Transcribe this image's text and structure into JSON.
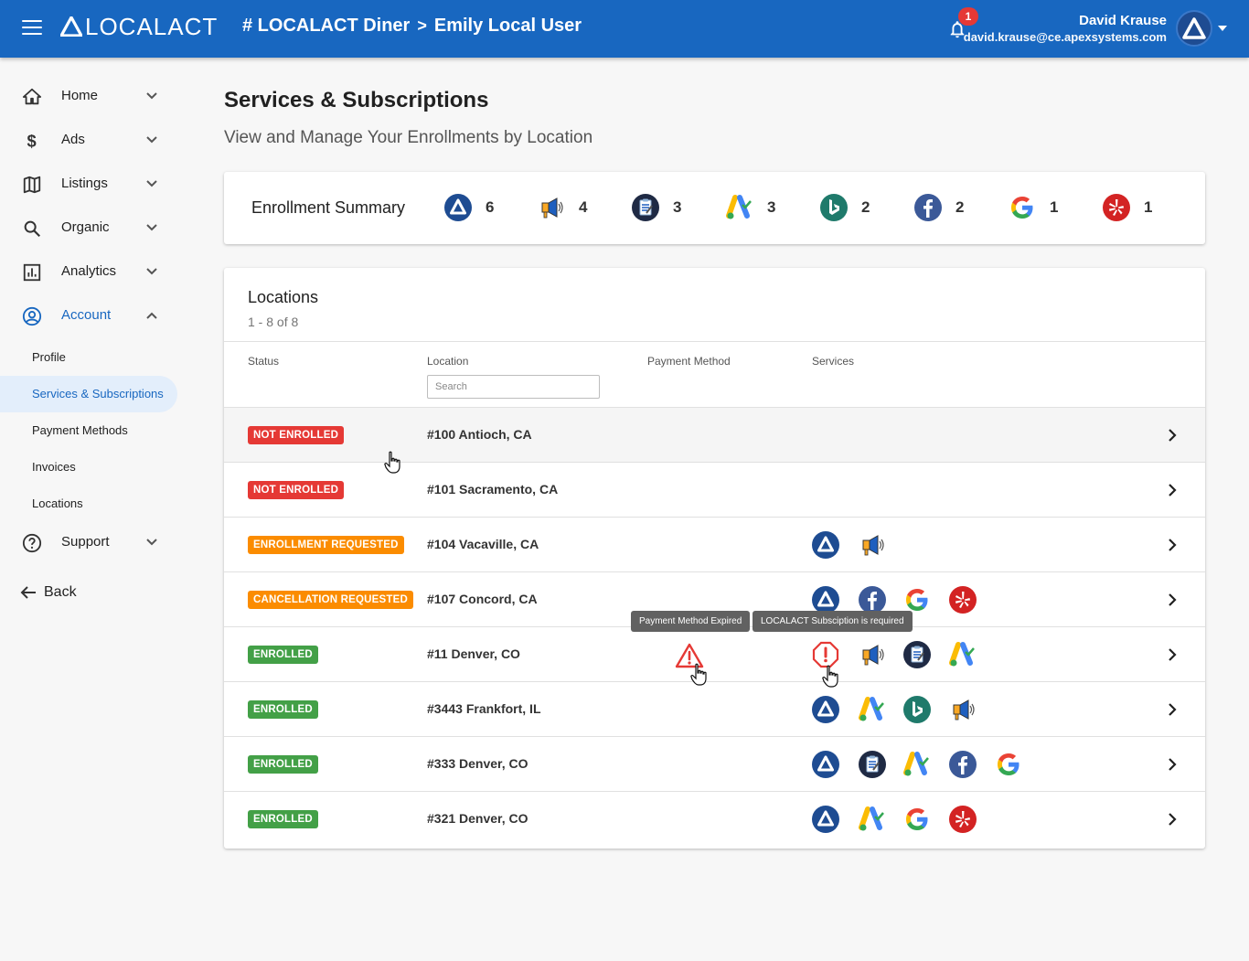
{
  "header": {
    "logo_text": "LOCALACT",
    "breadcrumb_store": "# LOCALACT Diner",
    "breadcrumb_sep": ">",
    "breadcrumb_user": "Emily Local User",
    "notifications_count": "1",
    "user_name": "David Krause",
    "user_email": "david.krause@ce.apexsystems.com"
  },
  "sidebar": {
    "items": [
      {
        "label": "Home",
        "icon": "home-icon"
      },
      {
        "label": "Ads",
        "icon": "dollar-icon"
      },
      {
        "label": "Listings",
        "icon": "map-icon"
      },
      {
        "label": "Organic",
        "icon": "search-icon"
      },
      {
        "label": "Analytics",
        "icon": "analytics-icon"
      },
      {
        "label": "Account",
        "icon": "account-circle-icon"
      }
    ],
    "account_sub": [
      "Profile",
      "Services & Subscriptions",
      "Payment Methods",
      "Invoices",
      "Locations"
    ],
    "support_label": "Support",
    "back_label": "Back"
  },
  "page": {
    "title": "Services & Subscriptions",
    "subtitle": "View and Manage Your Enrollments by Location"
  },
  "summary": {
    "title": "Enrollment Summary",
    "items": [
      {
        "service": "localact",
        "count": "6"
      },
      {
        "service": "megaphone",
        "count": "4"
      },
      {
        "service": "clipboard",
        "count": "3"
      },
      {
        "service": "google-ads",
        "count": "3"
      },
      {
        "service": "bing",
        "count": "2"
      },
      {
        "service": "facebook",
        "count": "2"
      },
      {
        "service": "google",
        "count": "1"
      },
      {
        "service": "yelp",
        "count": "1"
      }
    ]
  },
  "locations": {
    "title": "Locations",
    "range": "1 - 8 of 8",
    "columns": {
      "status": "Status",
      "location": "Location",
      "payment": "Payment Method",
      "services": "Services"
    },
    "search_placeholder": "Search",
    "rows": [
      {
        "status": "NOT ENROLLED",
        "status_color": "#e53935",
        "location": "#100 Antioch, CA",
        "services": [],
        "payment_warning": false
      },
      {
        "status": "NOT ENROLLED",
        "status_color": "#e53935",
        "location": "#101 Sacramento, CA",
        "services": [],
        "payment_warning": false
      },
      {
        "status": "ENROLLMENT REQUESTED",
        "status_color": "#fb8c00",
        "location": "#104 Vacaville, CA",
        "services": [
          "localact",
          "megaphone"
        ],
        "payment_warning": false
      },
      {
        "status": "CANCELLATION REQUESTED",
        "status_color": "#fb8c00",
        "location": "#107 Concord, CA",
        "services": [
          "localact",
          "facebook",
          "google",
          "yelp"
        ],
        "payment_warning": false
      },
      {
        "status": "ENROLLED",
        "status_color": "#43a047",
        "location": "#11 Denver, CO",
        "services": [
          "alert",
          "megaphone",
          "clipboard",
          "google-ads"
        ],
        "payment_warning": true
      },
      {
        "status": "ENROLLED",
        "status_color": "#43a047",
        "location": "#3443 Frankfort, IL",
        "services": [
          "localact",
          "google-ads",
          "bing",
          "megaphone"
        ],
        "payment_warning": false
      },
      {
        "status": "ENROLLED",
        "status_color": "#43a047",
        "location": "#333 Denver, CO",
        "services": [
          "localact",
          "clipboard",
          "google-ads",
          "facebook",
          "google"
        ],
        "payment_warning": false
      },
      {
        "status": "ENROLLED",
        "status_color": "#43a047",
        "location": "#321 Denver, CO",
        "services": [
          "localact",
          "google-ads",
          "google",
          "yelp"
        ],
        "payment_warning": false
      }
    ],
    "tooltip_payment": "Payment Method Expired",
    "tooltip_subscription": "LOCALACT Subsciption is required"
  },
  "colors": {
    "primary": "#1867c0",
    "not_enrolled": "#e53935",
    "requested": "#fb8c00",
    "enrolled": "#43a047"
  }
}
